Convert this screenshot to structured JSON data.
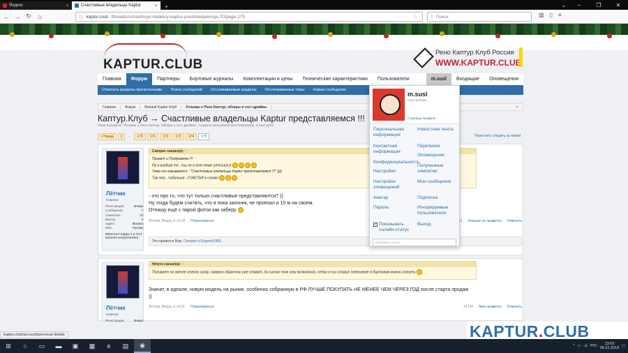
{
  "browser": {
    "tabs": [
      {
        "title": "Яндекс",
        "active": false
      },
      {
        "title": "Счастливые владельцы Kaptur",
        "active": true
      }
    ],
    "new_tab": "+",
    "url_host": "kaptur.club",
    "url_path": "/threads/schastlivye-vladelcy-kaptur-predstavljaemsja.70/page-175",
    "search_placeholder": "Поиск"
  },
  "site": {
    "logo_text": "KAPTUR.CLUB",
    "club_name": "Рено Каптур Клуб Россия",
    "club_url": "WWW.KAPTUR.CLUB",
    "accent_color": "#2f6ea7",
    "red_color": "#c0262d"
  },
  "nav": {
    "items": [
      "Главная",
      "Форум",
      "Партнеры",
      "Бортовые журналы",
      "Комплектации и цены",
      "Технические характеристики",
      "Пользователи"
    ],
    "active": "Форум",
    "user": "m.susl",
    "inbox": "Входящие",
    "alerts": "Оповещения"
  },
  "subnav": [
    "Отметить разделы прочитанными",
    "Поиск сообщений",
    "Отслеживаемые разделы",
    "Отслеживаемые темы",
    "Новые сообщения"
  ],
  "breadcrumb": [
    "Главная",
    "Форум",
    "Renault Kaptur Клуб",
    "Отзывы о Рено Каптур, обзоры и тест-драйвы"
  ],
  "page": {
    "title": "Каптур.Клуб → Счастливые владельцы Kaptur представляемся !!!",
    "meta": "Тема в разделе \"Отзывы о Рено Каптур, обзоры и тест-драйвы\", создана пользователем FanBassine, 8 июл 2016.",
    "watch": "Перестать следить за темой"
  },
  "pager": {
    "prev": "< Назад",
    "pages": [
      "1",
      "170",
      "171",
      "172",
      "173",
      "174",
      "175"
    ],
    "current": "175",
    "dots": "←"
  },
  "posts": [
    {
      "user": "Лётчик",
      "user_title": "Новичок",
      "stats": [
        {
          "label": "Регистрация:",
          "value": "Вчера"
        },
        {
          "label": "Сообщения:",
          "value": "7"
        },
        {
          "label": "Симпатии:",
          "value": "12"
        },
        {
          "label": "Баллы:",
          "value": "3"
        },
        {
          "label": "Адрес:",
          "value": "Москва"
        },
        {
          "label": "Имя:",
          "value": "Руслан"
        }
      ],
      "car": "RENAULT Kaptur 1.6 CVT Extreme Ivory/Chestnut",
      "quote_head": "Campan сказал(а): ↑",
      "quote_lines": [
        "Привет и Поздравляю !!!",
        "Ну в вообще то , ты не в той теме отписался",
        "Тема то называется - \"Счастливые владельцы Kaptur представляемся !!!\" ))))",
        "Так что , побольше - СЧАСТЬЯ в словах"
      ],
      "text_lines": [
        "- это про то, что тут только счастливые представляются? ))",
        "Ну тогда будем считать, что я пока заочник, не проехал и 10 м на своем.",
        "Отпишу ещё с парой фоток как заберу"
      ],
      "date": "Лётчик, Вчера, в 14:18",
      "report": "Пожаловаться",
      "number": "#1741",
      "dislike": "Больше не нравится",
      "reply": "Ответить",
      "likes_prefix": "Это нравится Вам,",
      "likes_users": "Campan и Evgenio1965",
      "likes_suffix": "."
    },
    {
      "user": "Лётчик",
      "user_title": "Новичок",
      "stats": [
        {
          "label": "Регистрация:",
          "value": "Вчера"
        },
        {
          "label": "Сообщения:",
          "value": "7"
        },
        {
          "label": "Симпатии:",
          "value": "12"
        },
        {
          "label": "Баллы:",
          "value": "3"
        }
      ],
      "quote_head": "fintyra сказал(а): ↑",
      "quote_lines": [
        "Поливает на заднее стекло сразу, наверно обратник уже ставят, да сигнал тож хочу волковский, сетку в низ ставил подешевле в бортовом можно глянуть"
      ],
      "text_lines": [
        "Значит, в идеале, новую модель на рынке, особенно собранную в РФ ЛУЧШЕ ПОКУПАТЬ НЕ МЕНЕЕ ЧЕМ ЧЕРЕЗ ГОД после старта продаж",
        "))"
      ],
      "date": "Лётчик, Вчера, в 14:21",
      "report": "Пожаловаться",
      "number": "#1742",
      "like": "Мне нравится",
      "reply": "Ответить"
    }
  ],
  "dropdown": {
    "name": "m.susl",
    "subtitle": "Наш человек",
    "profile_link": "Страница профиля",
    "left_links": [
      "Персональная информация",
      "Контактная информация",
      "Конфиденциальность",
      "Настройки",
      "Настройки оповещений",
      "Аватар",
      "Пароль"
    ],
    "right_links": [
      "Новостная лента",
      "Переписки",
      "Оповещения",
      "Полученные симпатии",
      "Мои сообщения",
      "Подписка",
      "Игнорируемые пользователи",
      "Выход"
    ],
    "online_status": "Показывать онлайн-статус",
    "status_placeholder": "Обновите статус..."
  },
  "watermark": {
    "left": "KAPTUR",
    "dot": ".",
    "right": "CLUB"
  },
  "statusbar_url": "kaptur.club/account/personal-details",
  "taskbar": {
    "lang": "РУС",
    "time": "13:03",
    "date": "06.01.2018"
  }
}
